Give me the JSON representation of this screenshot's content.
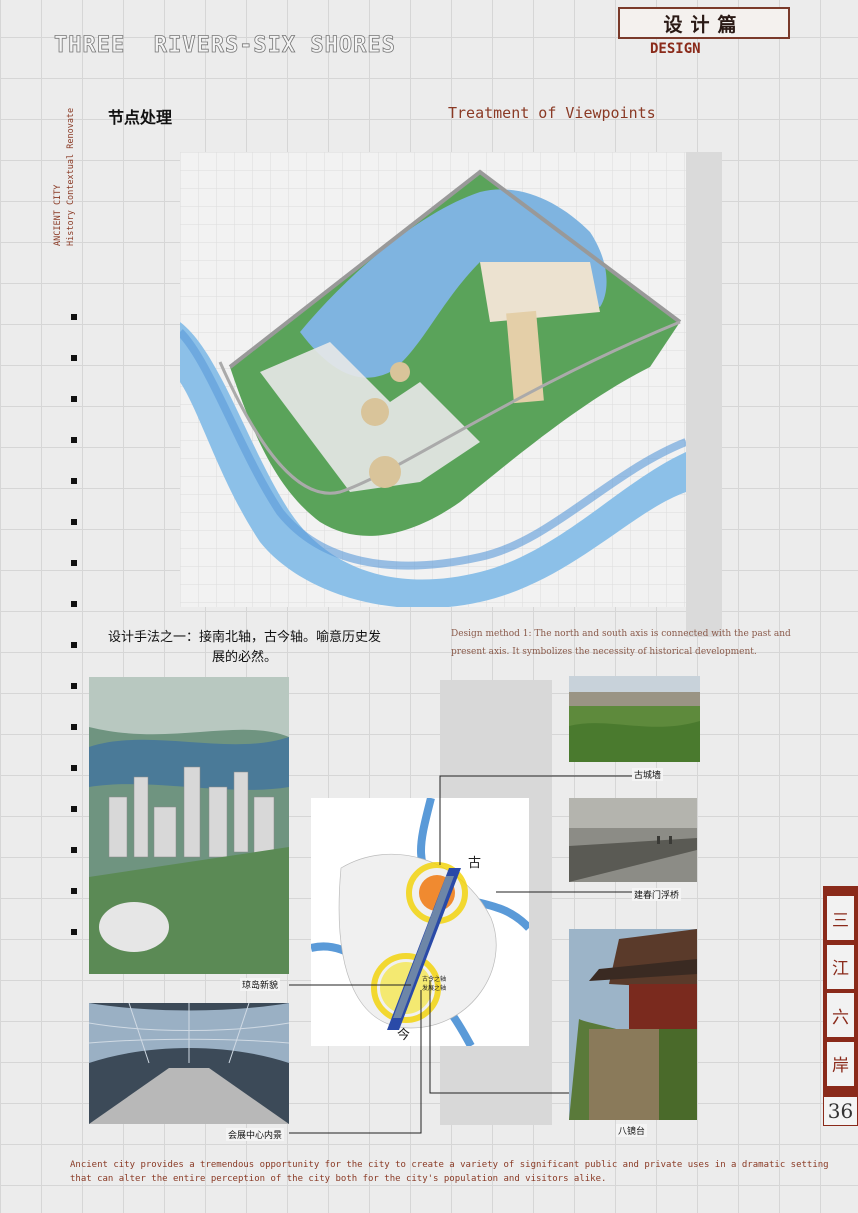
{
  "header": {
    "title": "THREE  RIVERS-SIX SHORES",
    "tag_cn": "设计篇",
    "tag_en": "DESIGN",
    "side_line1": "ANCIENT CITY",
    "side_line2": "History  Contextual Renovate"
  },
  "section": {
    "title_cn": "节点处理",
    "title_en": "Treatment of Viewpoints"
  },
  "method": {
    "cn_line1": "设计手法之一：接南北轴，古今轴。喻意历史发",
    "cn_line2": "展的必然。",
    "en": "Design method 1: The north and south axis is connected with the past and present axis. It symbolizes the necessity of historical development."
  },
  "captions": {
    "island": "琼岛新貌",
    "hall": "会展中心内景",
    "wall": "古城墙",
    "bridge": "建春门浮桥",
    "tower": "八镜台"
  },
  "axis_map": {
    "top_char": "古",
    "bottom_char": "今",
    "label_a": "古今之轴",
    "label_b": "发展之轴"
  },
  "sidebar": {
    "chars": [
      "三",
      "江",
      "六",
      "岸"
    ],
    "page_number": "36"
  },
  "footer": "Ancient city provides a tremendous opportunity for the city to create a variety of significant public and private uses in a dramatic setting that can alter the entire perception of the city both for the city's population and visitors alike.",
  "colors": {
    "accent": "#8a2a1a",
    "river": "#5a9ad8",
    "green": "#4a9a4a"
  }
}
